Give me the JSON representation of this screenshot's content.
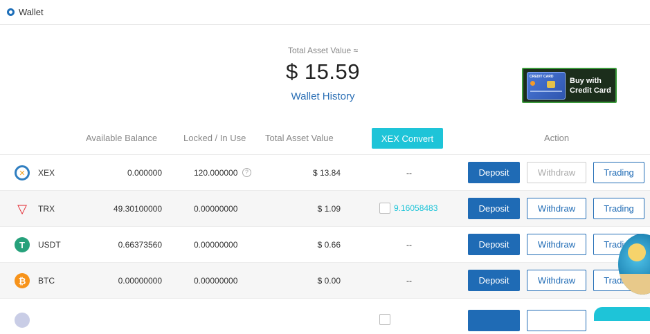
{
  "header": {
    "title": "Wallet"
  },
  "summary": {
    "total_label": "Total Asset Value ≈",
    "total_value": "$ 15.59",
    "history_link": "Wallet History"
  },
  "banner": {
    "card_label": "CREDIT CARD",
    "text_line1": "Buy with",
    "text_line2": "Credit Card"
  },
  "columns": {
    "available": "Available Balance",
    "locked": "Locked / In Use",
    "total": "Total Asset Value",
    "convert": "XEX Convert",
    "action": "Action"
  },
  "buttons": {
    "deposit": "Deposit",
    "withdraw": "Withdraw",
    "trading": "Trading"
  },
  "rows": [
    {
      "symbol": "XEX",
      "available": "0.000000",
      "locked": "120.000000",
      "total": "$ 13.84",
      "convert": "--",
      "color": "#2f7ec0",
      "glyph": "✕"
    },
    {
      "symbol": "TRX",
      "available": "49.30100000",
      "locked": "0.00000000",
      "total": "$ 1.09",
      "convert": "9.16058483",
      "color": "#e3222b",
      "glyph": "▽"
    },
    {
      "symbol": "USDT",
      "available": "0.66373560",
      "locked": "0.00000000",
      "total": "$ 0.66",
      "convert": "--",
      "color": "#26a17b",
      "glyph": "T"
    },
    {
      "symbol": "BTC",
      "available": "0.00000000",
      "locked": "0.00000000",
      "total": "$ 0.00",
      "convert": "--",
      "color": "#f7931a",
      "glyph": "₿"
    }
  ]
}
